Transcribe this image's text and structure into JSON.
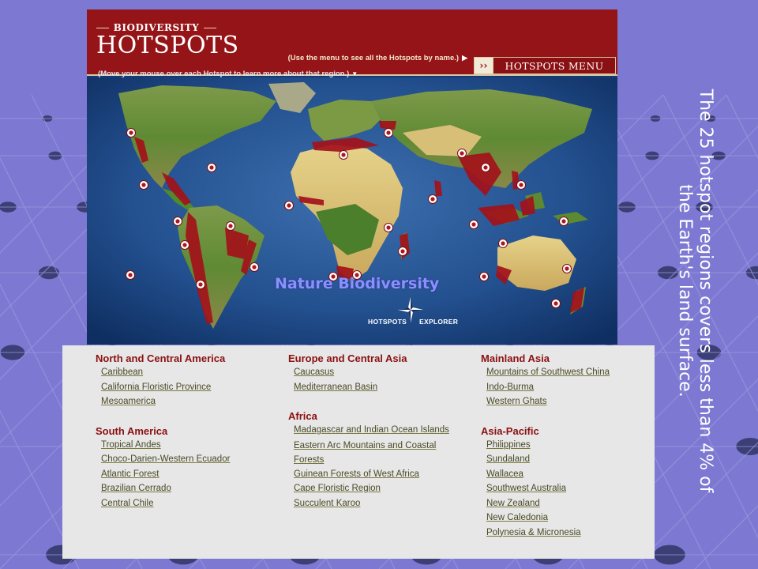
{
  "header": {
    "logo_small": "BIODIVERSITY",
    "logo_big": "HOTSPOTS",
    "menu_hint": "(Use the menu to see all the Hotspots by name.)",
    "menu_button": "HOTSPOTS MENU",
    "hover_hint": "(Move your mouse over each Hotspot to learn more about that region.)"
  },
  "map": {
    "overlay_title": "Nature Biodiversity",
    "explorer_left": "HOTSPOTS",
    "explorer_right": "EXPLORER",
    "colors": {
      "ocean": "#163a73",
      "hotspot_fill": "#a3121a",
      "header": "#951417"
    }
  },
  "columns": [
    {
      "groups": [
        {
          "title": "North and Central America",
          "items": [
            "Caribbean",
            "California Floristic Province",
            "Mesoamerica"
          ]
        },
        {
          "title": "South America",
          "items": [
            "Tropical Andes",
            "Choco-Darien-Western Ecuador",
            "Atlantic Forest",
            "Brazilian Cerrado",
            "Central Chile"
          ]
        }
      ]
    },
    {
      "groups": [
        {
          "title": "Europe and Central Asia",
          "items": [
            "Caucasus",
            "Mediterranean Basin"
          ]
        },
        {
          "title": "Africa",
          "items": [
            "Madagascar and Indian Ocean Islands",
            "Eastern Arc Mountains and Coastal Forests",
            "Guinean Forests of West Africa",
            "Cape Floristic Region",
            "Succulent Karoo"
          ]
        }
      ]
    },
    {
      "groups": [
        {
          "title": "Mainland Asia",
          "items": [
            "Mountains of Southwest China",
            "Indo-Burma",
            "Western Ghats"
          ]
        },
        {
          "title": "Asia-Pacific",
          "items": [
            "Philippines",
            "Sundaland",
            "Wallacea",
            "Southwest Australia",
            "New Zealand",
            "New Caledonia",
            "Polynesia & Micronesia"
          ]
        }
      ]
    }
  ],
  "caption": "The 25 hotspot regions covers less than 4% of the Earth's land surface."
}
